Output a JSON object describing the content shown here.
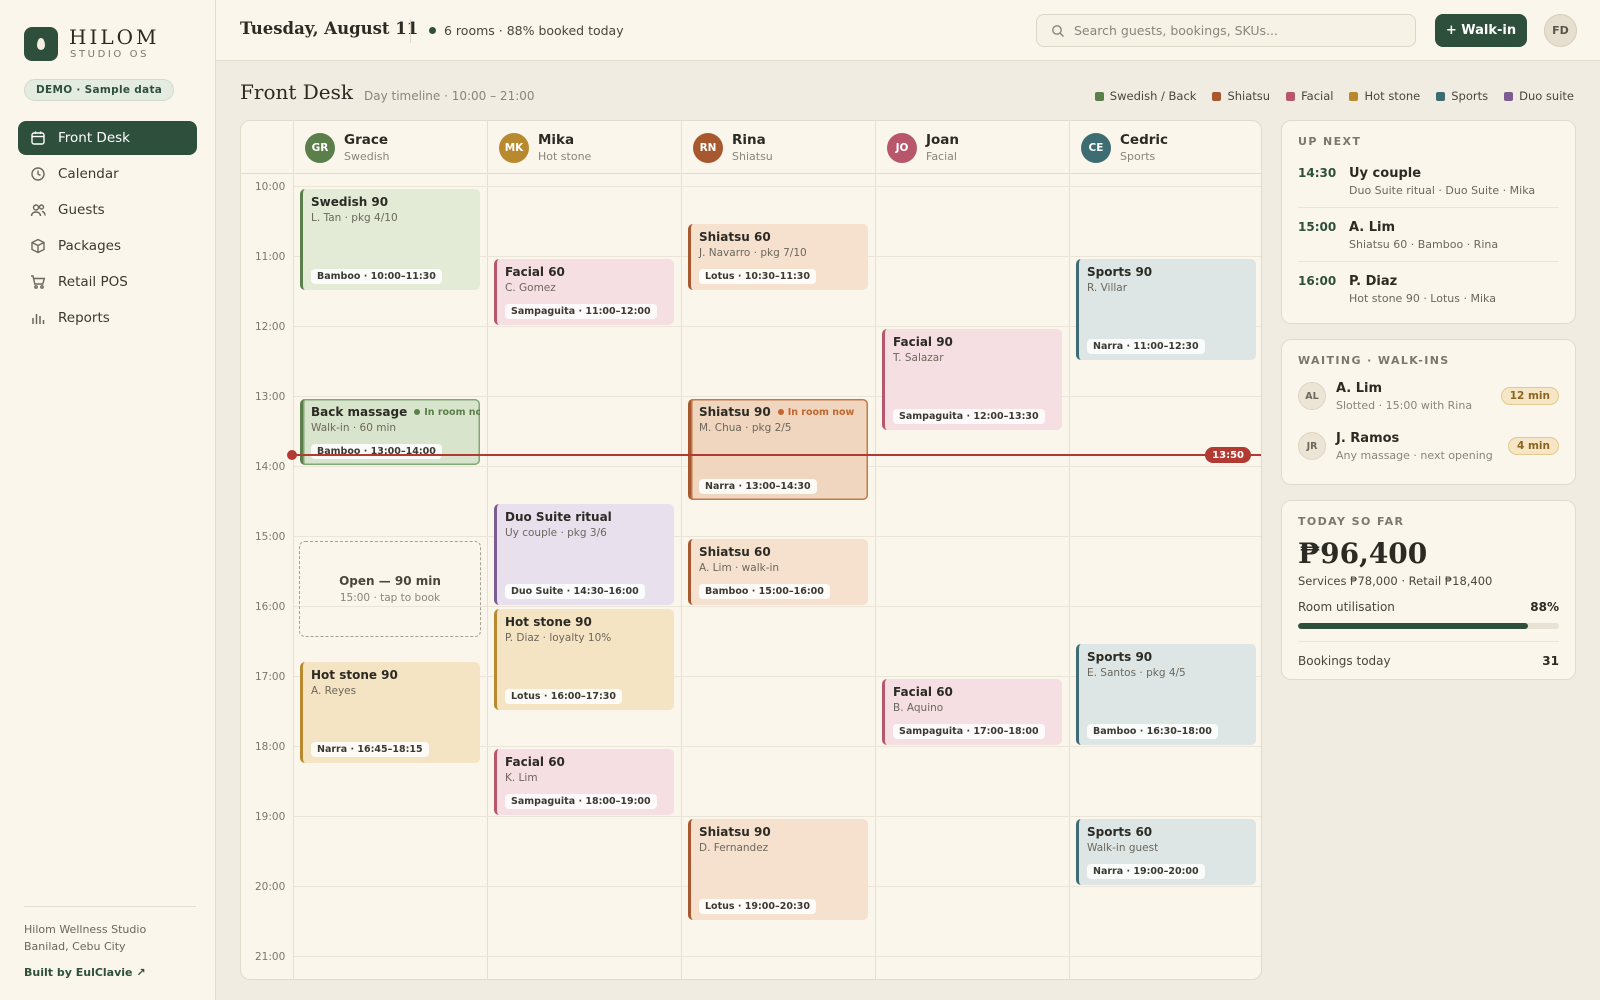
{
  "brand": {
    "name": "HILOM",
    "sub": "STUDIO OS",
    "demo_badge": "DEMO · Sample data"
  },
  "nav": [
    {
      "label": "Front Desk",
      "icon": "calendar-icon",
      "active": true
    },
    {
      "label": "Calendar",
      "icon": "clock-icon",
      "active": false
    },
    {
      "label": "Guests",
      "icon": "users-icon",
      "active": false
    },
    {
      "label": "Packages",
      "icon": "box-icon",
      "active": false
    },
    {
      "label": "Retail POS",
      "icon": "cart-icon",
      "active": false
    },
    {
      "label": "Reports",
      "icon": "bar-chart-icon",
      "active": false
    }
  ],
  "footer": {
    "studio": "Hilom Wellness Studio",
    "location": "Banilad, Cebu City",
    "built_by": "Built by EulClavie ↗"
  },
  "topbar": {
    "date": "Tuesday, August 11",
    "status": "6 rooms · 88% booked today",
    "search_placeholder": "Search guests, bookings, SKUs...",
    "walkin_label": "+ Walk-in",
    "user_initials": "FD"
  },
  "section": {
    "title": "Front Desk",
    "subtitle": "Day timeline · 10:00 – 21:00"
  },
  "legend": [
    {
      "label": "Swedish / Back",
      "color": "#5b7f4a"
    },
    {
      "label": "Shiatsu",
      "color": "#a8582f"
    },
    {
      "label": "Facial",
      "color": "#b8566b"
    },
    {
      "label": "Hot stone",
      "color": "#b8892e"
    },
    {
      "label": "Sports",
      "color": "#3d6d72"
    },
    {
      "label": "Duo suite",
      "color": "#7b5d92"
    }
  ],
  "therapists": [
    {
      "initials": "GR",
      "name": "Grace",
      "specialty": "Swedish",
      "color": "#5b7f4a"
    },
    {
      "initials": "MK",
      "name": "Mika",
      "specialty": "Hot stone",
      "color": "#b8892e"
    },
    {
      "initials": "RN",
      "name": "Rina",
      "specialty": "Shiatsu",
      "color": "#a8582f"
    },
    {
      "initials": "JO",
      "name": "Joan",
      "specialty": "Facial",
      "color": "#b8566b"
    },
    {
      "initials": "CE",
      "name": "Cedric",
      "specialty": "Sports",
      "color": "#3d6d72"
    }
  ],
  "hours": [
    "10:00",
    "11:00",
    "12:00",
    "13:00",
    "14:00",
    "15:00",
    "16:00",
    "17:00",
    "18:00",
    "19:00",
    "20:00",
    "21:00"
  ],
  "now_time": "13:50",
  "appointments": [
    {
      "col": 0,
      "start": "10:00",
      "end": "11:30",
      "title": "Swedish 90",
      "sub": "L. Tan · pkg 4/10",
      "pill": "Bamboo · 10:00–11:30",
      "kind": "swedish"
    },
    {
      "col": 0,
      "start": "13:00",
      "end": "14:00",
      "title": "Back massage",
      "sub": "Walk-in · 60 min",
      "pill": "Bamboo · 13:00–14:00",
      "kind": "swedish-live",
      "live": "In room now",
      "live_color": "#5b7f4a"
    },
    {
      "col": 0,
      "start": "16:45",
      "end": "18:15",
      "title": "Hot stone 90",
      "sub": "A. Reyes",
      "pill": "Narra · 16:45–18:15",
      "kind": "hotstone"
    },
    {
      "col": 1,
      "start": "11:00",
      "end": "12:00",
      "title": "Facial 60",
      "sub": "C. Gomez",
      "pill": "Sampaguita · 11:00–12:00",
      "kind": "facial"
    },
    {
      "col": 1,
      "start": "14:30",
      "end": "16:00",
      "title": "Duo Suite ritual",
      "sub": "Uy couple · pkg 3/6",
      "pill": "Duo Suite · 14:30–16:00",
      "kind": "duo"
    },
    {
      "col": 1,
      "start": "16:00",
      "end": "17:30",
      "title": "Hot stone 90",
      "sub": "P. Diaz · loyalty 10%",
      "pill": "Lotus · 16:00–17:30",
      "kind": "hotstone"
    },
    {
      "col": 1,
      "start": "18:00",
      "end": "19:00",
      "title": "Facial 60",
      "sub": "K. Lim",
      "pill": "Sampaguita · 18:00–19:00",
      "kind": "facial"
    },
    {
      "col": 2,
      "start": "10:30",
      "end": "11:30",
      "title": "Shiatsu 60",
      "sub": "J. Navarro · pkg 7/10",
      "pill": "Lotus · 10:30–11:30",
      "kind": "shiatsu"
    },
    {
      "col": 2,
      "start": "13:00",
      "end": "14:30",
      "title": "Shiatsu 90",
      "sub": "M. Chua · pkg 2/5",
      "pill": "Narra · 13:00–14:30",
      "kind": "shiatsu-live",
      "live": "In room now",
      "live_color": "#c0662f"
    },
    {
      "col": 2,
      "start": "15:00",
      "end": "16:00",
      "title": "Shiatsu 60",
      "sub": "A. Lim · walk-in",
      "pill": "Bamboo · 15:00–16:00",
      "kind": "shiatsu"
    },
    {
      "col": 2,
      "start": "19:00",
      "end": "20:30",
      "title": "Shiatsu 90",
      "sub": "D. Fernandez",
      "pill": "Lotus · 19:00–20:30",
      "kind": "shiatsu"
    },
    {
      "col": 3,
      "start": "12:00",
      "end": "13:30",
      "title": "Facial 90",
      "sub": "T. Salazar",
      "pill": "Sampaguita · 12:00–13:30",
      "kind": "facial"
    },
    {
      "col": 3,
      "start": "17:00",
      "end": "18:00",
      "title": "Facial 60",
      "sub": "B. Aquino",
      "pill": "Sampaguita · 17:00–18:00",
      "kind": "facial"
    },
    {
      "col": 4,
      "start": "11:00",
      "end": "12:30",
      "title": "Sports 90",
      "sub": "R. Villar",
      "pill": "Narra · 11:00–12:30",
      "kind": "sports"
    },
    {
      "col": 4,
      "start": "16:30",
      "end": "18:00",
      "title": "Sports 90",
      "sub": "E. Santos · pkg 4/5",
      "pill": "Bamboo · 16:30–18:00",
      "kind": "sports"
    },
    {
      "col": 4,
      "start": "19:00",
      "end": "20:00",
      "title": "Sports 60",
      "sub": "Walk-in guest",
      "pill": "Narra · 19:00–20:00",
      "kind": "sports"
    }
  ],
  "open_slot": {
    "col": 0,
    "start": "15:00",
    "end": "16:30",
    "title": "Open — 90 min",
    "sub": "15:00 · tap to book"
  },
  "up_next": {
    "title": "UP NEXT",
    "items": [
      {
        "time": "14:30",
        "name": "Uy couple",
        "detail": "Duo Suite ritual · Duo Suite · Mika"
      },
      {
        "time": "15:00",
        "name": "A. Lim",
        "detail": "Shiatsu 60 · Bamboo · Rina"
      },
      {
        "time": "16:00",
        "name": "P. Diaz",
        "detail": "Hot stone 90 · Lotus · Mika"
      }
    ]
  },
  "waiting": {
    "title": "WAITING · WALK-INS",
    "items": [
      {
        "initials": "AL",
        "name": "A. Lim",
        "detail": "Slotted · 15:00 with Rina",
        "wait": "12 min"
      },
      {
        "initials": "JR",
        "name": "J. Ramos",
        "detail": "Any massage · next opening",
        "wait": "4 min"
      }
    ]
  },
  "today": {
    "title": "TODAY SO FAR",
    "revenue": "₱96,400",
    "breakdown": "Services ₱78,000 · Retail ₱18,400",
    "utilisation_label": "Room utilisation",
    "utilisation_value": "88%",
    "utilisation_fraction": 0.88,
    "bookings_label": "Bookings today",
    "bookings_value": "31"
  }
}
